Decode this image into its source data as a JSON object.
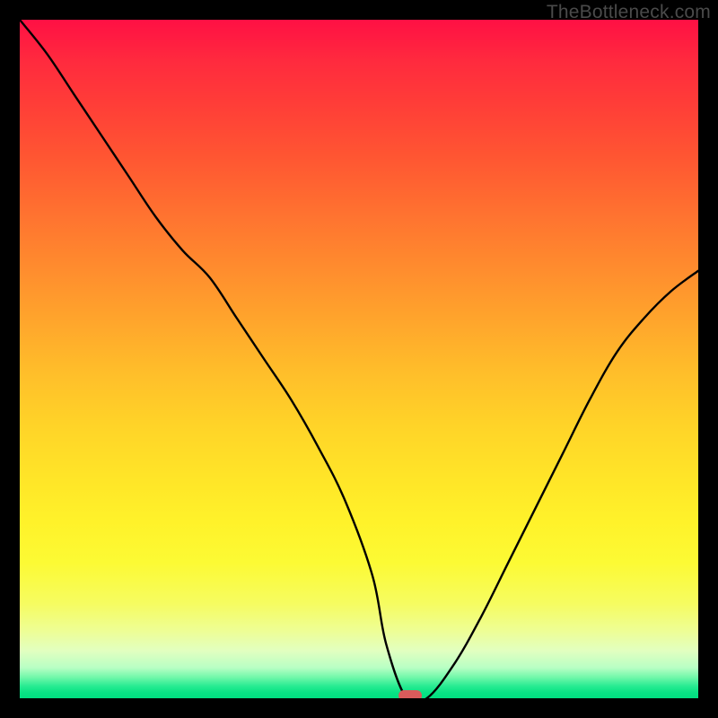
{
  "watermark": "TheBottleneck.com",
  "colors": {
    "frame_bg": "#000000",
    "curve_stroke": "#000000",
    "marker_fill": "#d95b5b"
  },
  "plot": {
    "inner_left": 22,
    "inner_top": 22,
    "inner_width": 756,
    "inner_height": 756
  },
  "chart_data": {
    "type": "line",
    "title": "",
    "xlabel": "",
    "ylabel": "",
    "xlim": [
      0,
      100
    ],
    "ylim": [
      0,
      100
    ],
    "x": [
      0,
      4,
      8,
      12,
      16,
      20,
      24,
      28,
      32,
      36,
      40,
      44,
      48,
      52,
      54,
      57,
      60,
      64,
      68,
      72,
      76,
      80,
      84,
      88,
      92,
      96,
      100
    ],
    "values": [
      100,
      95,
      89,
      83,
      77,
      71,
      66,
      62,
      56,
      50,
      44,
      37,
      29,
      18,
      8,
      0,
      0,
      5,
      12,
      20,
      28,
      36,
      44,
      51,
      56,
      60,
      63
    ],
    "marker": {
      "x": 57.5,
      "y": 0
    },
    "note": "x and y are in percentage-of-plot-area units; curve is a V-shaped bottleneck indicator with a flat minimum segment near x≈55–60."
  }
}
